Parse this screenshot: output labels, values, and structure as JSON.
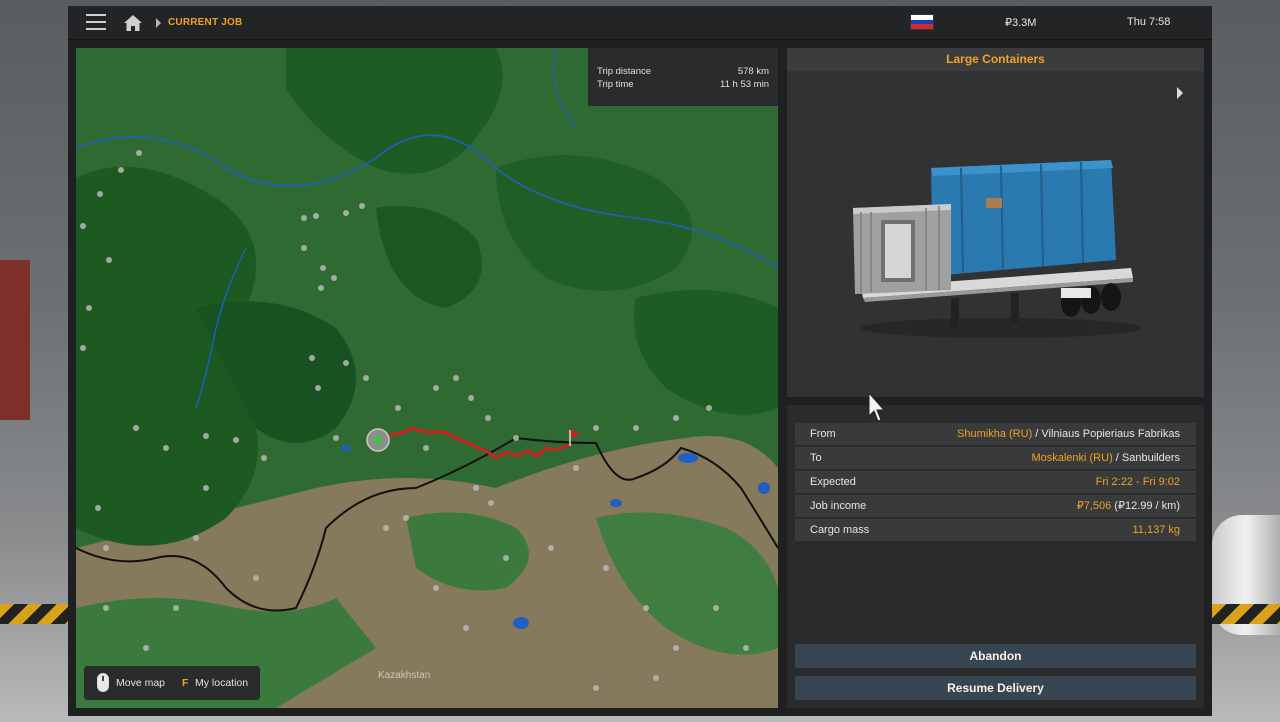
{
  "topbar": {
    "breadcrumb": "CURRENT JOB",
    "money": "₽3.3M",
    "time": "Thu 7:58",
    "flag_colors": [
      "#ffffff",
      "#1c3fb8",
      "#d22b2b"
    ]
  },
  "map": {
    "trip_distance_label": "Trip distance",
    "trip_distance_value": "578 km",
    "trip_time_label": "Trip time",
    "trip_time_value": "11 h 53 min",
    "country_label": "Kazakhstan",
    "hint_move": "Move map",
    "hint_key": "F",
    "hint_location": "My location"
  },
  "cargo": {
    "name": "Large Containers"
  },
  "details": {
    "from_label": "From",
    "from_city": "Shumikha (RU)",
    "from_company": " / Vilniaus Popieriaus Fabrikas",
    "to_label": "To",
    "to_city": "Moskalenki (RU)",
    "to_company": " / Sanbuilders",
    "expected_label": "Expected",
    "expected_value": "Fri 2:22 - Fri 9:02",
    "income_label": "Job income",
    "income_value": "₽7,506",
    "income_rate": " (₽12.99 / km)",
    "mass_label": "Cargo mass",
    "mass_value": "11,137 kg"
  },
  "buttons": {
    "abandon": "Abandon",
    "resume": "Resume Delivery"
  },
  "colors": {
    "accent": "#f0a322",
    "button": "#394652",
    "route": "#d21f1f"
  }
}
